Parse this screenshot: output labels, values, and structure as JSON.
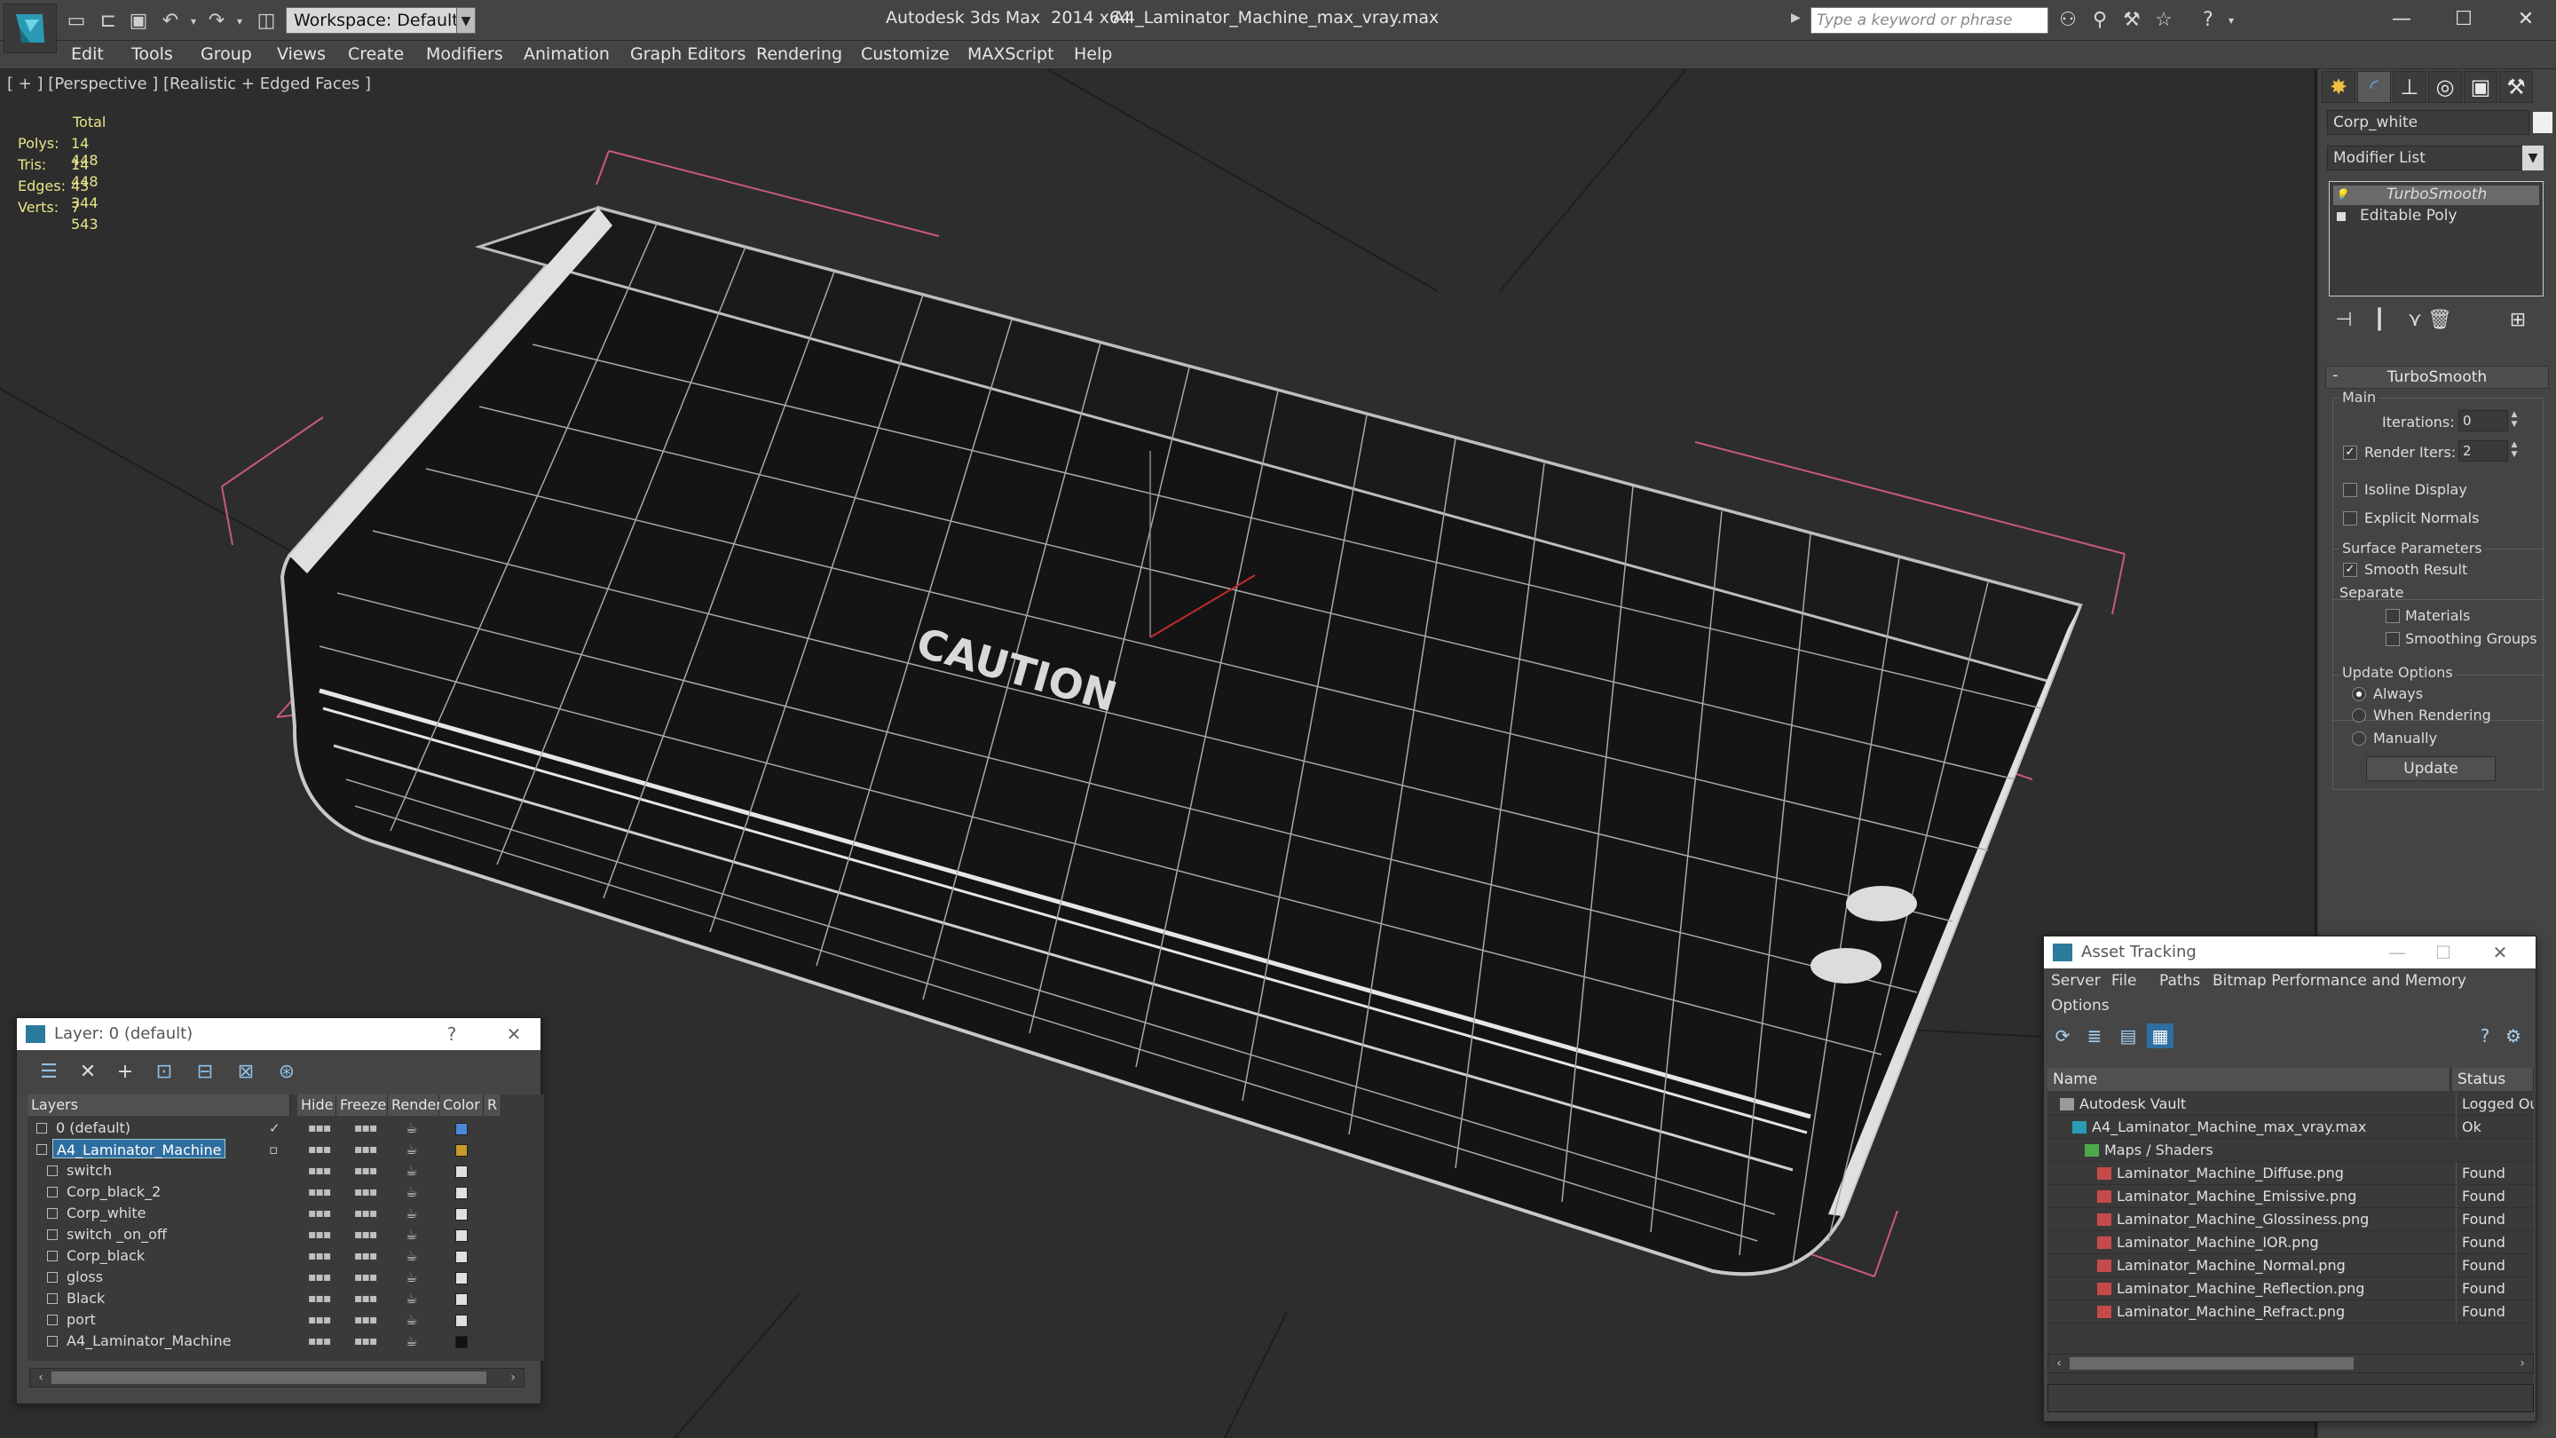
{
  "titlebar": {
    "app_title": "Autodesk 3ds Max  2014 x64",
    "file_title": "A4_Laminator_Machine_max_vray.max",
    "workspace": "Workspace: Default",
    "search_placeholder": "Type a keyword or phrase"
  },
  "menu": [
    "Edit",
    "Tools",
    "Group",
    "Views",
    "Create",
    "Modifiers",
    "Animation",
    "Graph Editors",
    "Rendering",
    "Customize",
    "MAXScript",
    "Help"
  ],
  "viewport": {
    "label": "[ + ] [Perspective ] [Realistic + Edged Faces ]",
    "stats_header": "Total",
    "stats": [
      {
        "label": "Polys:",
        "value": "14 448"
      },
      {
        "label": "Tris:",
        "value": "14 448"
      },
      {
        "label": "Edges:",
        "value": "43 344"
      },
      {
        "label": "Verts:",
        "value": "7 543"
      }
    ],
    "decal_text": "CAUTION"
  },
  "command_panel": {
    "object_name": "Corp_white",
    "object_color": "#f0f0f0",
    "modifier_list": "Modifier List",
    "stack": [
      {
        "label": "TurboSmooth",
        "selected": true
      },
      {
        "label": "Editable Poly",
        "selected": false
      }
    ],
    "rollout_title": "TurboSmooth",
    "main_group": "Main",
    "iterations_label": "Iterations:",
    "iterations_value": "0",
    "render_iters_label": "Render Iters:",
    "render_iters_value": "2",
    "render_iters_checked": true,
    "isoline_label": "Isoline Display",
    "explicit_normals_label": "Explicit Normals",
    "surface_group": "Surface Parameters",
    "smooth_result_label": "Smooth Result",
    "separate_label": "Separate",
    "materials_label": "Materials",
    "smoothing_groups_label": "Smoothing Groups",
    "update_group": "Update Options",
    "always_label": "Always",
    "when_rendering_label": "When Rendering",
    "manually_label": "Manually",
    "update_button": "Update"
  },
  "layer_dialog": {
    "title": "Layer: 0 (default)",
    "help": "?",
    "columns": [
      "Layers",
      "Hide",
      "Freeze",
      "Render",
      "Color",
      "R"
    ],
    "rows": [
      {
        "name": "0 (default)",
        "level": 0,
        "color": "#4a8ad8",
        "selected": false,
        "checked": true
      },
      {
        "name": "A4_Laminator_Machine",
        "level": 0,
        "color": "#c89a2a",
        "selected": true,
        "checked": false
      },
      {
        "name": "switch",
        "level": 1,
        "color": "#e0e0e0",
        "selected": false
      },
      {
        "name": "Corp_black_2",
        "level": 1,
        "color": "#e0e0e0",
        "selected": false
      },
      {
        "name": "Corp_white",
        "level": 1,
        "color": "#e0e0e0",
        "selected": false
      },
      {
        "name": "switch _on_off",
        "level": 1,
        "color": "#e0e0e0",
        "selected": false
      },
      {
        "name": "Corp_black",
        "level": 1,
        "color": "#e0e0e0",
        "selected": false
      },
      {
        "name": "gloss",
        "level": 1,
        "color": "#e0e0e0",
        "selected": false
      },
      {
        "name": "Black",
        "level": 1,
        "color": "#e0e0e0",
        "selected": false
      },
      {
        "name": "port",
        "level": 1,
        "color": "#e0e0e0",
        "selected": false
      },
      {
        "name": "A4_Laminator_Machine",
        "level": 1,
        "color": "#111111",
        "selected": false
      }
    ]
  },
  "asset_dialog": {
    "title": "Asset Tracking",
    "menu": [
      "Server",
      "File",
      "Paths",
      "Bitmap Performance and Memory",
      "Options"
    ],
    "columns": [
      "Name",
      "Status"
    ],
    "rows": [
      {
        "name": "Autodesk Vault",
        "status": "Logged Out",
        "level": 0,
        "kind": "vault"
      },
      {
        "name": "A4_Laminator_Machine_max_vray.max",
        "status": "Ok",
        "level": 1,
        "kind": "max"
      },
      {
        "name": "Maps / Shaders",
        "status": "",
        "level": 2,
        "kind": "maps"
      },
      {
        "name": "Laminator_Machine_Diffuse.png",
        "status": "Found",
        "level": 3,
        "kind": "png"
      },
      {
        "name": "Laminator_Machine_Emissive.png",
        "status": "Found",
        "level": 3,
        "kind": "png"
      },
      {
        "name": "Laminator_Machine_Glossiness.png",
        "status": "Found",
        "level": 3,
        "kind": "png"
      },
      {
        "name": "Laminator_Machine_IOR.png",
        "status": "Found",
        "level": 3,
        "kind": "png"
      },
      {
        "name": "Laminator_Machine_Normal.png",
        "status": "Found",
        "level": 3,
        "kind": "png"
      },
      {
        "name": "Laminator_Machine_Reflection.png",
        "status": "Found",
        "level": 3,
        "kind": "png"
      },
      {
        "name": "Laminator_Machine_Refract.png",
        "status": "Found",
        "level": 3,
        "kind": "png"
      }
    ]
  }
}
